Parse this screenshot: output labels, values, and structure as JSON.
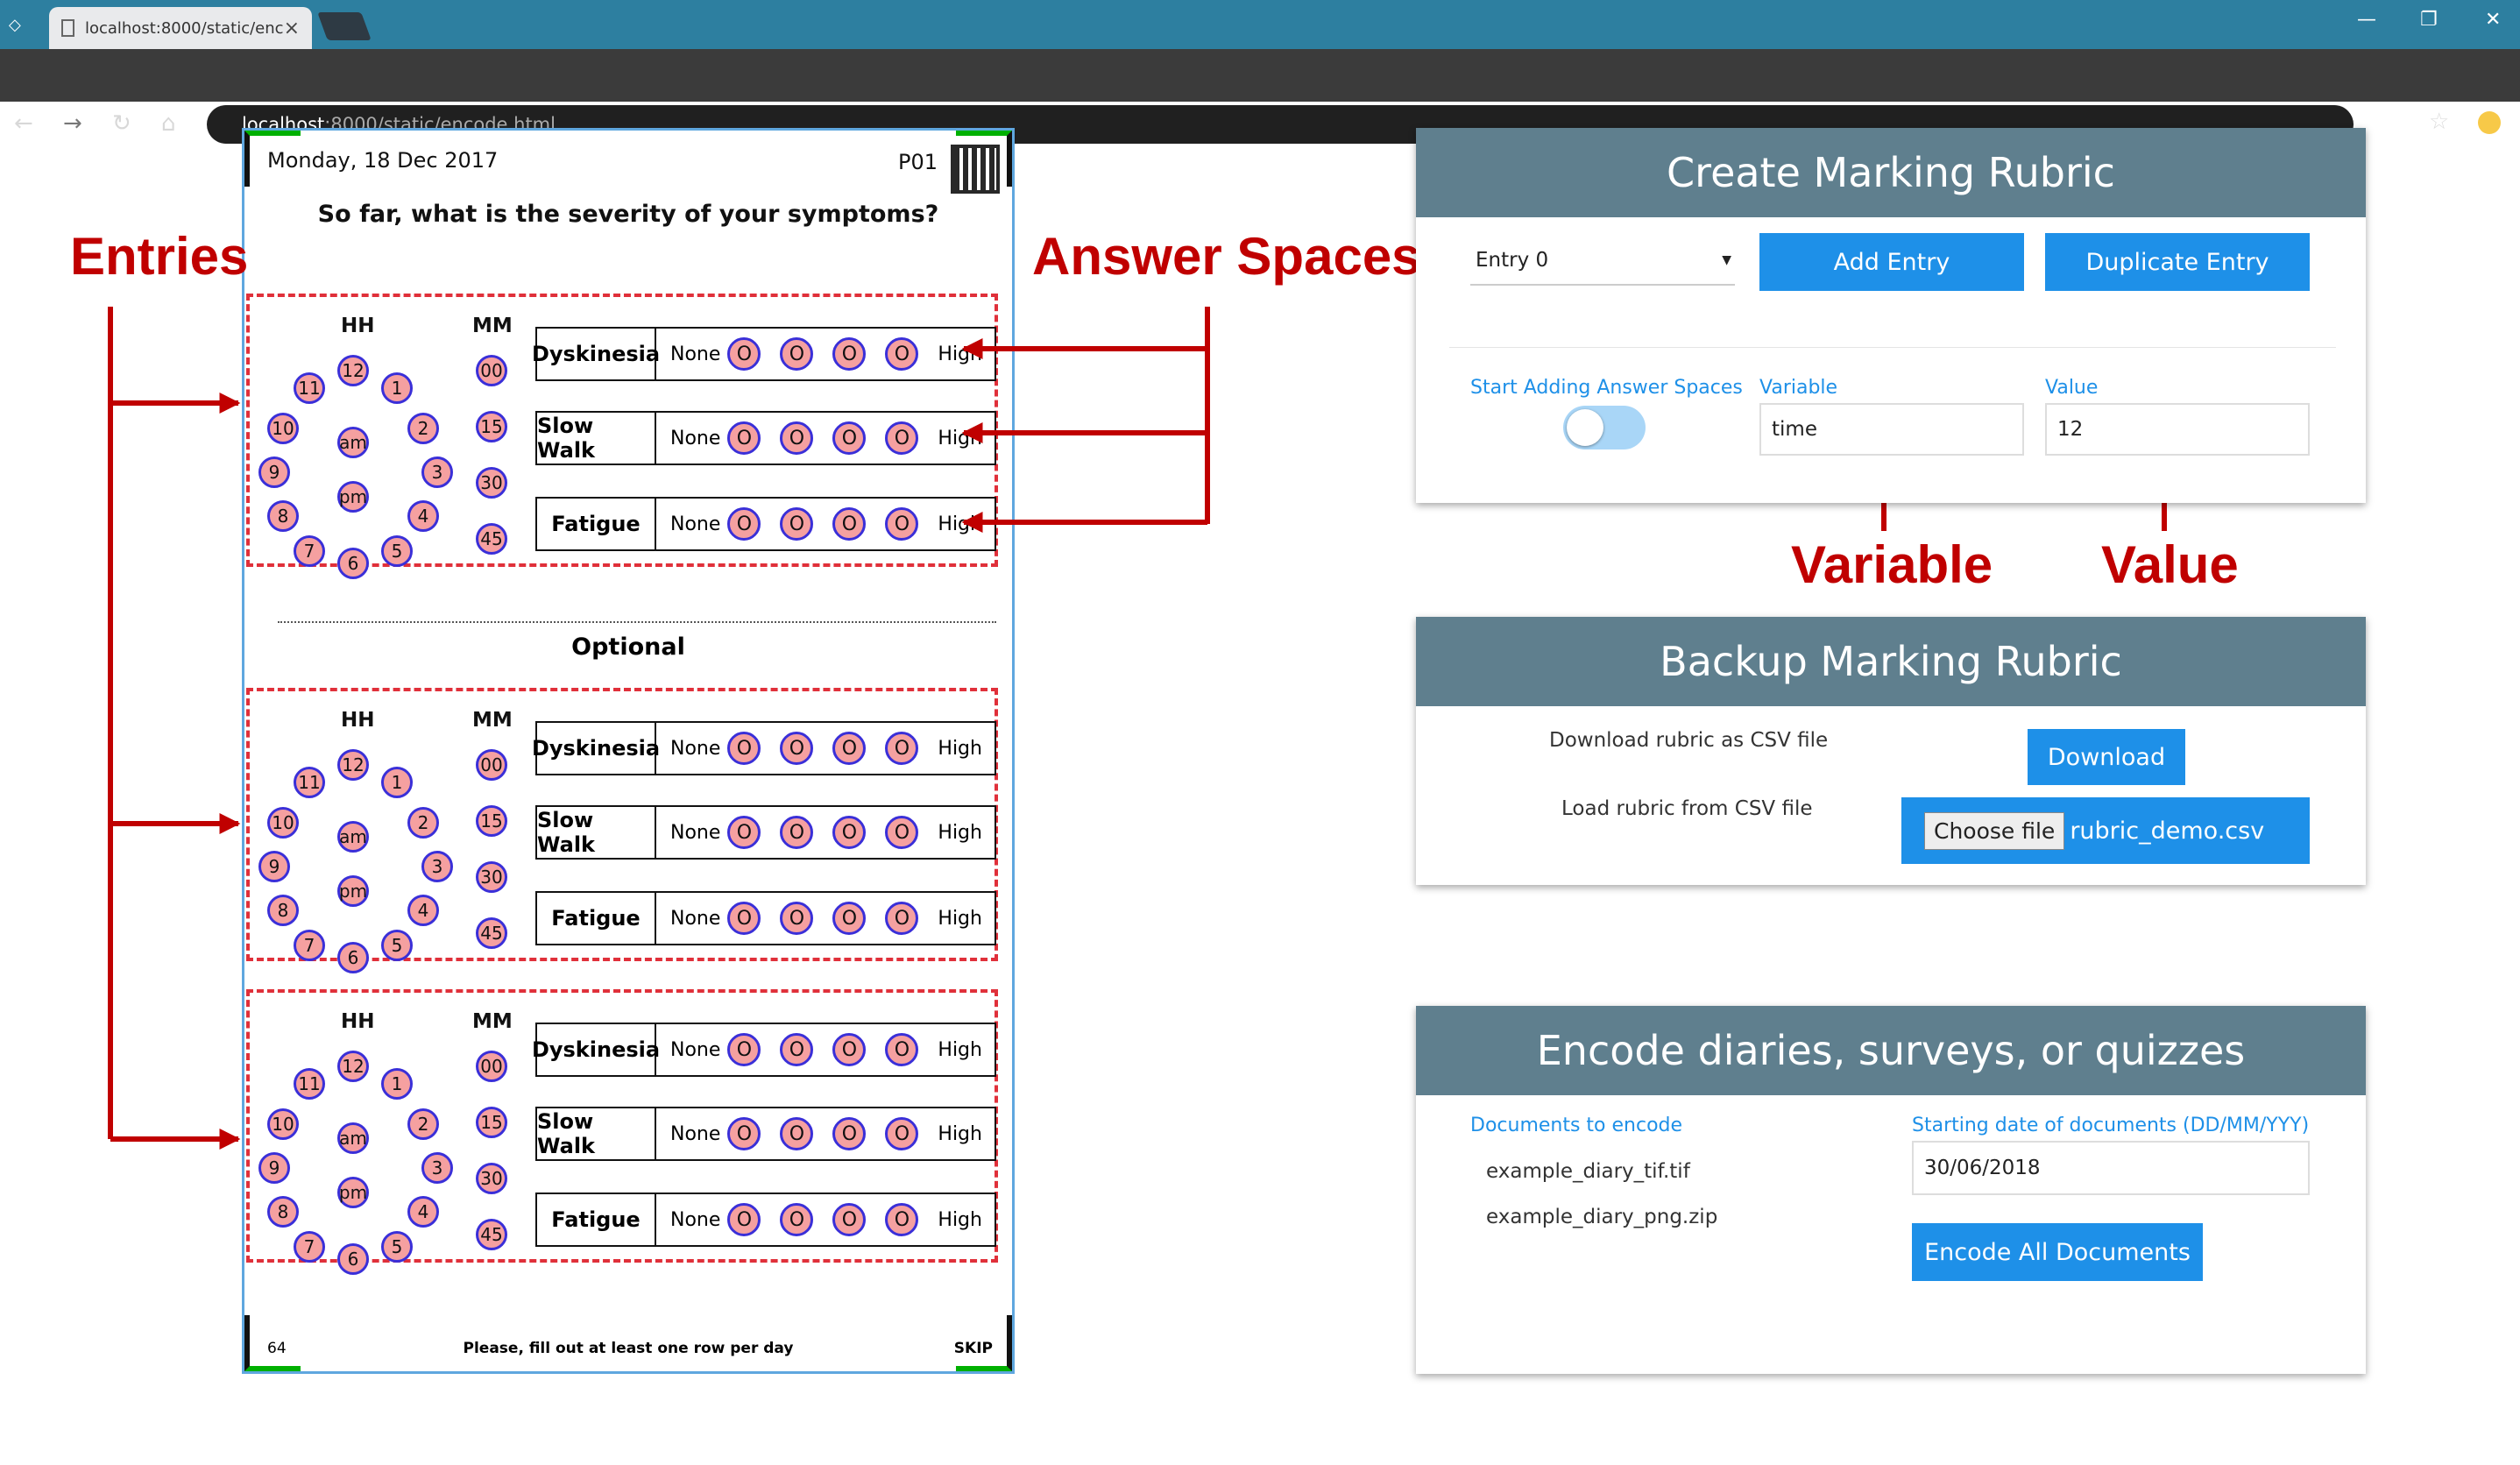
{
  "browser": {
    "tab_title": "localhost:8000/static/enc",
    "tab_close": "×",
    "url_host": "localhost",
    "url_rest": ":8000/static/encode.html"
  },
  "paper": {
    "date": "Monday, 18 Dec 2017",
    "id": "P01",
    "question": "So far, what is the severity of your symptoms?",
    "hh_label": "HH",
    "mm_label": "MM",
    "clock_hours": [
      "12",
      "1",
      "2",
      "3",
      "4",
      "5",
      "6",
      "7",
      "8",
      "9",
      "10",
      "11",
      "am",
      "pm"
    ],
    "minutes": [
      "00",
      "15",
      "30",
      "45"
    ],
    "rows": [
      "Dyskinesia",
      "Slow Walk",
      "Fatigue"
    ],
    "none_label": "None",
    "high_label": "High",
    "bubble_glyph": "O",
    "optional": "Optional",
    "footer": "Please, fill out at least one row per day",
    "page_number": "64",
    "skip": "SKIP"
  },
  "annotations": {
    "entries": "Entries",
    "answer_spaces": "Answer Spaces",
    "variable": "Variable",
    "value": "Value",
    "color": "#c00000"
  },
  "create_rubric": {
    "title": "Create Marking Rubric",
    "entry_select": "Entry 0",
    "add_entry": "Add Entry",
    "duplicate_entry": "Duplicate Entry",
    "toggle_label": "Start Adding Answer Spaces",
    "variable_label": "Variable",
    "variable_value": "time",
    "value_label": "Value",
    "value_value": "12"
  },
  "backup_rubric": {
    "title": "Backup Marking Rubric",
    "download_text": "Download rubric as CSV file",
    "download_button": "Download",
    "load_text": "Load rubric from CSV file",
    "choose_file": "Choose file",
    "file_name": "rubric_demo.csv"
  },
  "encode": {
    "title": "Encode diaries, surveys, or quizzes",
    "documents_label": "Documents to encode",
    "documents": [
      "example_diary_tif.tif",
      "example_diary_png.zip"
    ],
    "date_label": "Starting date of documents (DD/MM/YYY)",
    "date_value": "30/06/2018",
    "encode_button": "Encode All Documents"
  },
  "colors": {
    "accent": "#1e90e8",
    "card_header": "#5f7f8e",
    "dashed_box": "#e0303a",
    "bubble_fill": "#f5a0a0",
    "bubble_ring": "#3a2fd8"
  }
}
